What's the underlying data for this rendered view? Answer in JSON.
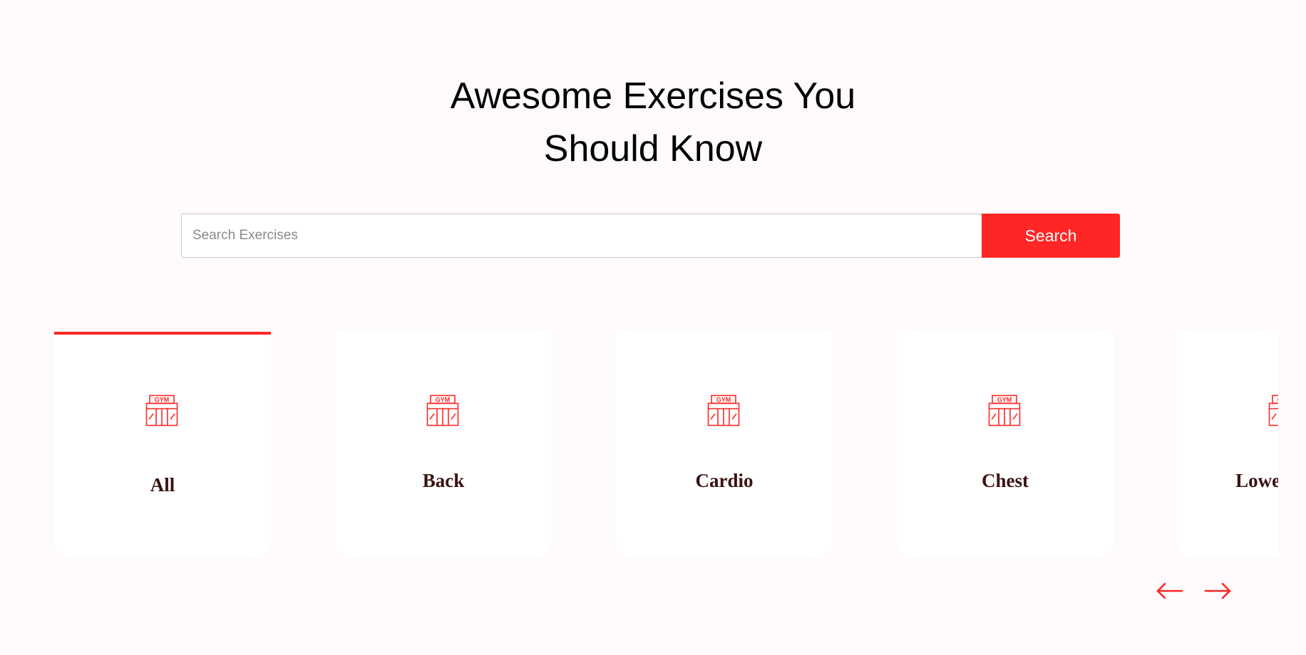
{
  "headline": {
    "line1": "Awesome Exercises You",
    "line2": "Should Know"
  },
  "search": {
    "placeholder": "Search Exercises",
    "value": "",
    "button_label": "Search"
  },
  "categories": {
    "icon": "gym-icon",
    "icon_text": "GYM",
    "active_index": 0,
    "items": [
      {
        "label": "All"
      },
      {
        "label": "Back"
      },
      {
        "label": "Cardio"
      },
      {
        "label": "Chest"
      },
      {
        "label": "Lower arms"
      }
    ]
  },
  "carousel_nav": {
    "left_icon": "arrow-left-icon",
    "right_icon": "arrow-right-icon"
  },
  "colors": {
    "accent": "#ff2625",
    "background": "#fffafb",
    "card_label": "#3a1212"
  }
}
